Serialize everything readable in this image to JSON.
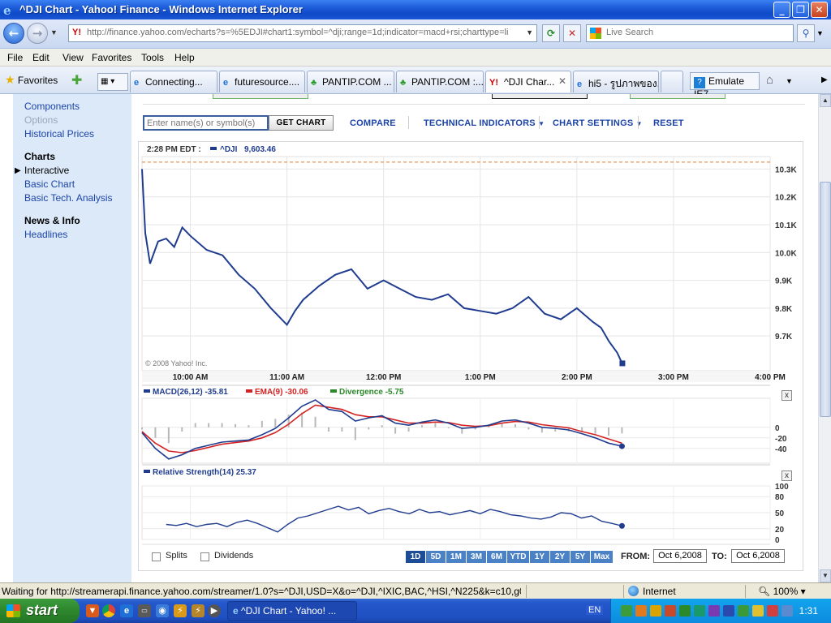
{
  "window": {
    "title": "^DJI Chart - Yahoo! Finance - Windows Internet Explorer",
    "minimize": "_",
    "maximize": "❐",
    "close": "✕"
  },
  "address": {
    "url": "http://finance.yahoo.com/echarts?s=%5EDJI#chart1:symbol=^dji;range=1d;indicator=macd+rsi;charttype=li",
    "search_placeholder": "Live Search"
  },
  "menu": [
    "File",
    "Edit",
    "View",
    "Favorites",
    "Tools",
    "Help"
  ],
  "favorites_label": "Favorites",
  "tabs": [
    {
      "label": "Connecting...",
      "icon": "ie-icon"
    },
    {
      "label": "futuresource....",
      "icon": "ie-icon"
    },
    {
      "label": "PANTIP.COM ...",
      "icon": "cactus-icon"
    },
    {
      "label": "PANTIP.COM :...",
      "icon": "cactus-icon"
    },
    {
      "label": "^DJI Char...",
      "icon": "yahoo-icon",
      "active": true
    },
    {
      "label": "hi5 - รูปภาพของ...",
      "icon": "ie-icon"
    }
  ],
  "emulate_label": "Emulate IE7",
  "sidebar": {
    "items": [
      {
        "label": "Components",
        "kind": "link"
      },
      {
        "label": "Options",
        "kind": "disabled"
      },
      {
        "label": "Historical Prices",
        "kind": "link"
      },
      {
        "label": "Charts",
        "kind": "head"
      },
      {
        "label": "Interactive",
        "kind": "current"
      },
      {
        "label": "Basic Chart",
        "kind": "link"
      },
      {
        "label": "Basic Tech. Analysis",
        "kind": "link"
      },
      {
        "label": "News & Info",
        "kind": "head"
      },
      {
        "label": "Headlines",
        "kind": "link"
      }
    ]
  },
  "toolbar": {
    "symbol_placeholder": "Enter name(s) or symbol(s)",
    "get_chart": "GET CHART",
    "compare": "COMPARE",
    "technical_indicators": "TECHNICAL INDICATORS",
    "chart_settings": "CHART SETTINGS",
    "reset": "RESET"
  },
  "chart_data": [
    {
      "type": "line",
      "timestamp": "2:28 PM EDT :",
      "symbol_label": "^DJI",
      "last_value": "9,603.46",
      "copyright": "© 2008 Yahoo! Inc.",
      "x_ticks": [
        "10:00 AM",
        "11:00 AM",
        "12:00 PM",
        "1:00 PM",
        "2:00 PM",
        "3:00 PM",
        "4:00 PM"
      ],
      "y_ticks": [
        "10.3K",
        "10.2K",
        "10.1K",
        "10.0K",
        "9.9K",
        "9.8K",
        "9.7K"
      ],
      "y_tick_values": [
        10300,
        10200,
        10100,
        10000,
        9900,
        9800,
        9700
      ],
      "ylim": [
        9575,
        10345
      ],
      "reference_line": 10325,
      "x": [
        "9:30",
        "9:32",
        "9:35",
        "9:40",
        "9:45",
        "9:50",
        "9:55",
        "10:00",
        "10:10",
        "10:20",
        "10:30",
        "10:40",
        "10:50",
        "11:00",
        "11:05",
        "11:10",
        "11:20",
        "11:30",
        "11:40",
        "11:50",
        "12:00",
        "12:10",
        "12:20",
        "12:30",
        "12:40",
        "12:50",
        "13:00",
        "13:10",
        "13:20",
        "13:30",
        "13:40",
        "13:50",
        "14:00",
        "14:10",
        "14:15",
        "14:20",
        "14:25",
        "14:28"
      ],
      "values": [
        10300,
        10070,
        9960,
        10040,
        10050,
        10020,
        10090,
        10060,
        10010,
        9990,
        9920,
        9870,
        9800,
        9740,
        9790,
        9830,
        9880,
        9920,
        9940,
        9870,
        9900,
        9870,
        9840,
        9830,
        9850,
        9800,
        9790,
        9780,
        9800,
        9840,
        9780,
        9760,
        9800,
        9750,
        9730,
        9680,
        9640,
        9603
      ]
    },
    {
      "type": "line",
      "series": [
        {
          "name": "MACD(26,12)",
          "last": "-35.81",
          "color": "#203c8f",
          "values": [
            -10,
            -40,
            -60,
            -52,
            -40,
            -34,
            -28,
            -26,
            -24,
            -14,
            -2,
            18,
            40,
            52,
            34,
            30,
            12,
            18,
            22,
            8,
            4,
            10,
            14,
            8,
            -2,
            0,
            4,
            12,
            14,
            8,
            0,
            -2,
            -5,
            -12,
            -20,
            -30,
            -35.81
          ]
        },
        {
          "name": "EMA(9)",
          "last": "-30.06",
          "color": "#d42222",
          "values": [
            -8,
            -30,
            -45,
            -48,
            -44,
            -38,
            -32,
            -29,
            -26,
            -20,
            -10,
            6,
            26,
            42,
            38,
            34,
            24,
            20,
            20,
            14,
            8,
            8,
            10,
            9,
            4,
            2,
            3,
            8,
            11,
            10,
            5,
            2,
            -1,
            -8,
            -14,
            -22,
            -30.06
          ]
        },
        {
          "name": "Divergence",
          "last": "-5.75",
          "color": "#2a8a2a",
          "values": []
        }
      ],
      "y_ticks": [
        "0",
        "-20",
        "-40"
      ],
      "y_tick_values": [
        0,
        -20,
        -40
      ],
      "ylim": [
        -68,
        55
      ]
    },
    {
      "type": "line",
      "series": [
        {
          "name": "Relative Strength(14)",
          "last": "25.37",
          "color": "#203c8f",
          "values": [
            28,
            26,
            30,
            24,
            28,
            30,
            24,
            32,
            36,
            30,
            22,
            14,
            28,
            40,
            44,
            50,
            56,
            62,
            55,
            60,
            48,
            54,
            58,
            52,
            48,
            56,
            50,
            52,
            46,
            50,
            54,
            48,
            56,
            52,
            46,
            44,
            40,
            38,
            42,
            50,
            48,
            40,
            44,
            34,
            30,
            25.37
          ]
        }
      ],
      "y_ticks": [
        "100",
        "80",
        "50",
        "20",
        "0"
      ],
      "y_tick_values": [
        100,
        80,
        50,
        20,
        0
      ],
      "ylim": [
        0,
        100
      ]
    }
  ],
  "chart_controls": {
    "splits": "Splits",
    "dividends": "Dividends",
    "ranges": [
      "1D",
      "5D",
      "1M",
      "3M",
      "6M",
      "YTD",
      "1Y",
      "2Y",
      "5Y",
      "Max"
    ],
    "selected_range": "1D",
    "from_label": "FROM:",
    "from_value": "Oct 6,2008",
    "to_label": "TO:",
    "to_value": "Oct 6,2008",
    "close_x": "x"
  },
  "status": {
    "text": "Waiting for http://streamerapi.finance.yahoo.com/streamer/1.0?s=^DJI,USD=X&o=^DJI,^IXIC,BAC,^HSI,^N225&k=c10,g00,h",
    "zone": "Internet",
    "zoom": "100%"
  },
  "taskbar": {
    "start": "start",
    "task": "^DJI Chart - Yahoo! ...",
    "lang": "EN",
    "clock": "1:31"
  }
}
